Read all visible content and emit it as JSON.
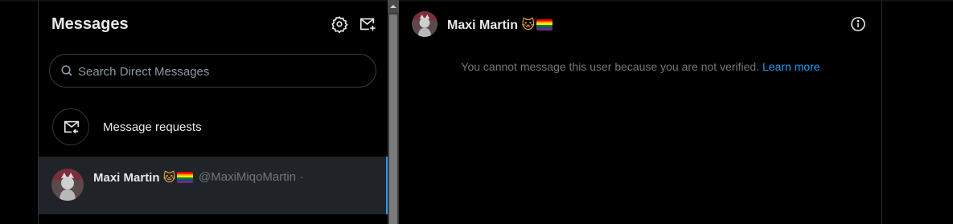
{
  "messages_panel": {
    "title": "Messages",
    "settings_icon": "gear-icon",
    "new_message_icon": "compose-message-icon"
  },
  "search": {
    "placeholder": "Search Direct Messages"
  },
  "requests": {
    "label": "Message requests",
    "icon": "message-requests-icon"
  },
  "conversations": [
    {
      "name": "Maxi Martin",
      "emoji_cat": "🐱",
      "handle": "@MaxiMiqoMartin",
      "separator": "·",
      "selected": true
    }
  ],
  "conversation_view": {
    "name": "Maxi Martin",
    "emoji_cat": "🐱",
    "info_icon": "info-icon",
    "notice_text": "You cannot message this user because you are not verified.",
    "notice_link": "Learn more"
  },
  "colors": {
    "background": "#000000",
    "accent": "#1d9bf0",
    "selected_row": "#202327",
    "muted_text": "#71767b"
  }
}
